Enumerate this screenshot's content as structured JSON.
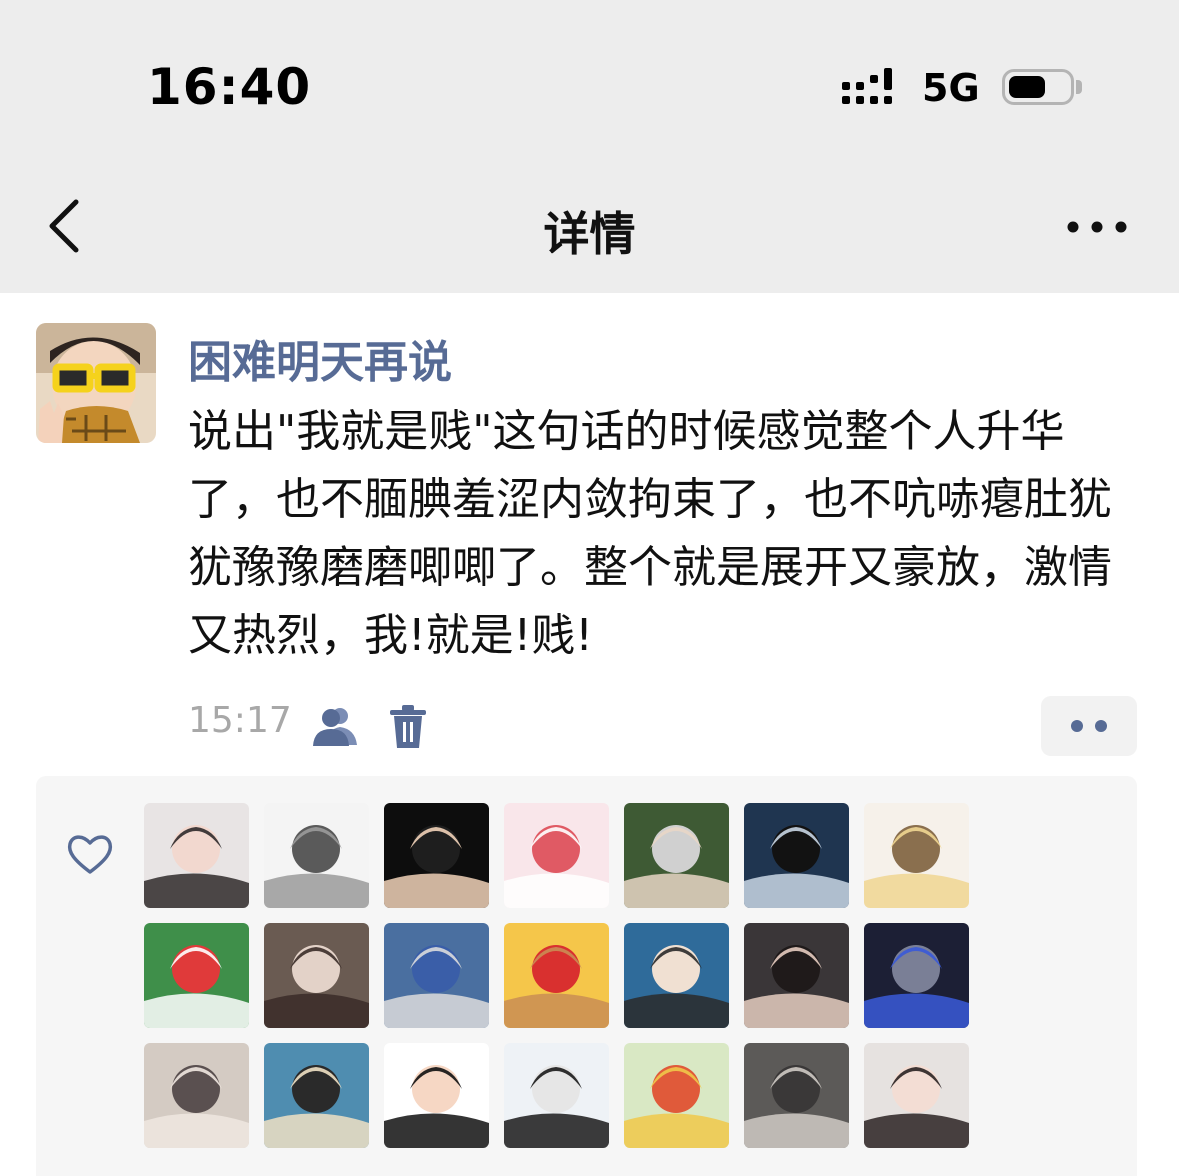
{
  "status_bar": {
    "time": "16:40",
    "network": "5G",
    "battery_level": 0.6
  },
  "nav": {
    "title": "详情",
    "back_icon": "chevron-left-icon",
    "more_icon": "more-horizontal-icon"
  },
  "post": {
    "author": "困难明天再说",
    "text": "说出\"我就是贱\"这句话的时候感觉整个人升华了，也不腼腆羞涩内敛拘束了，也不吭哧瘪肚犹犹豫豫磨磨唧唧了。整个就是展开又豪放，激情又热烈，我!就是!贱!",
    "time": "15:17"
  },
  "likes": {
    "icon": "heart-outline-icon",
    "accent_color": "#576b95",
    "avatars": [
      {
        "palette": [
          "#e8e4e4",
          "#2f2a2a",
          "#f2d8cf"
        ]
      },
      {
        "palette": [
          "#f4f4f4",
          "#9a9a9a",
          "#5a5a5a"
        ]
      },
      {
        "palette": [
          "#0d0d0d",
          "#f1d2b8",
          "#1e1e1e"
        ]
      },
      {
        "palette": [
          "#f9e6ea",
          "#ffffff",
          "#e05a64"
        ]
      },
      {
        "palette": [
          "#3e5a34",
          "#e8d6c6",
          "#d0d0d0"
        ]
      },
      {
        "palette": [
          "#1f3550",
          "#c9d6e4",
          "#121212"
        ]
      },
      {
        "palette": [
          "#f6f1ea",
          "#f0d692",
          "#8a6f4e"
        ]
      },
      {
        "palette": [
          "#3f8f4a",
          "#ffffff",
          "#e03a3a"
        ]
      },
      {
        "palette": [
          "#6a5b52",
          "#3a2c28",
          "#e3d2c8"
        ]
      },
      {
        "palette": [
          "#4a6fa0",
          "#dcdcdc",
          "#3a5ea8"
        ]
      },
      {
        "palette": [
          "#f5c64a",
          "#c98d54",
          "#d9302f"
        ]
      },
      {
        "palette": [
          "#2f6b9a",
          "#2a2a2a",
          "#f0e0d2"
        ]
      },
      {
        "palette": [
          "#3a3638",
          "#e5ccc0",
          "#1f1a1a"
        ]
      },
      {
        "palette": [
          "#1c1f35",
          "#3a5ad8",
          "#7a7f96"
        ]
      },
      {
        "palette": [
          "#d4cbc3",
          "#efe7e0",
          "#5a5050"
        ]
      },
      {
        "palette": [
          "#4f8db0",
          "#efe1c4",
          "#2a2a2a"
        ]
      },
      {
        "palette": [
          "#ffffff",
          "#111111",
          "#f6d7c4"
        ]
      },
      {
        "palette": [
          "#eef2f6",
          "#1a1a1a",
          "#e6e6e6"
        ]
      },
      {
        "palette": [
          "#d9e8c4",
          "#f0c84a",
          "#e05a3a"
        ]
      },
      {
        "palette": [
          "#5c5a58",
          "#cfcac4",
          "#3a3838"
        ]
      },
      {
        "palette": [
          "#e6e2e0",
          "#2a2222",
          "#f3ddd4"
        ]
      }
    ]
  }
}
